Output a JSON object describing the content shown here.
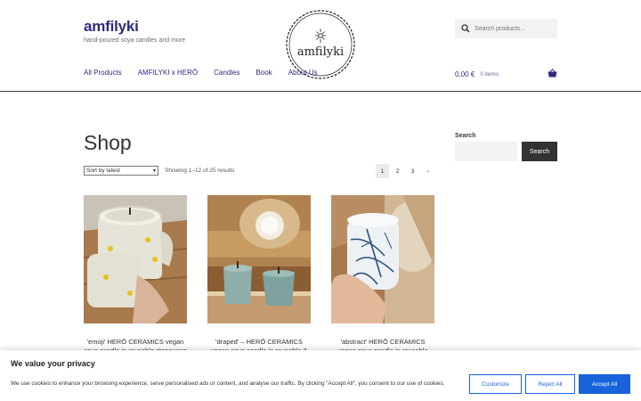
{
  "site": {
    "title": "amfilyki",
    "tagline": "hand-poured soya candles and more",
    "logo_text": "amfilyki"
  },
  "search": {
    "placeholder": "Search products…",
    "icon": "search-icon"
  },
  "nav": {
    "items": [
      {
        "label": "All Products"
      },
      {
        "label": "AMFILYKI x HERŌ"
      },
      {
        "label": "Candles"
      },
      {
        "label": "Book"
      },
      {
        "label": "About Us"
      }
    ]
  },
  "cart": {
    "amount": "0,00 €",
    "count": "0 items",
    "icon": "basket-icon"
  },
  "main": {
    "page_title": "Shop",
    "sort": {
      "selected": "Sort by latest"
    },
    "result_count": "Showing 1–12 of 25 results",
    "pagination": [
      "1",
      "2",
      "3",
      "→"
    ],
    "current_page": "1"
  },
  "products": [
    {
      "title": "'emoji' HERŌ CERAMICS vegan soya candle in reusable stoneware"
    },
    {
      "title": "'draped' – HERŌ CERAMICS vegan soya candle in reusable & recycled"
    },
    {
      "title": "'abstract' HERŌ CERAMICS vegan soya candle in reusable stoneware"
    }
  ],
  "sidebar": {
    "search_title": "Search",
    "search_button": "Search"
  },
  "cookie": {
    "title": "We value your privacy",
    "text": "We use cookies to enhance your browsing experience, serve personalised ads or content, and analyse our traffic. By clicking \"Accept All\", you consent to our use of cookies.",
    "customize": "Customize",
    "reject": "Reject All",
    "accept": "Accept All"
  },
  "colors": {
    "brand": "#2c2d7c",
    "accent": "#1863dc",
    "dark": "#333333"
  }
}
